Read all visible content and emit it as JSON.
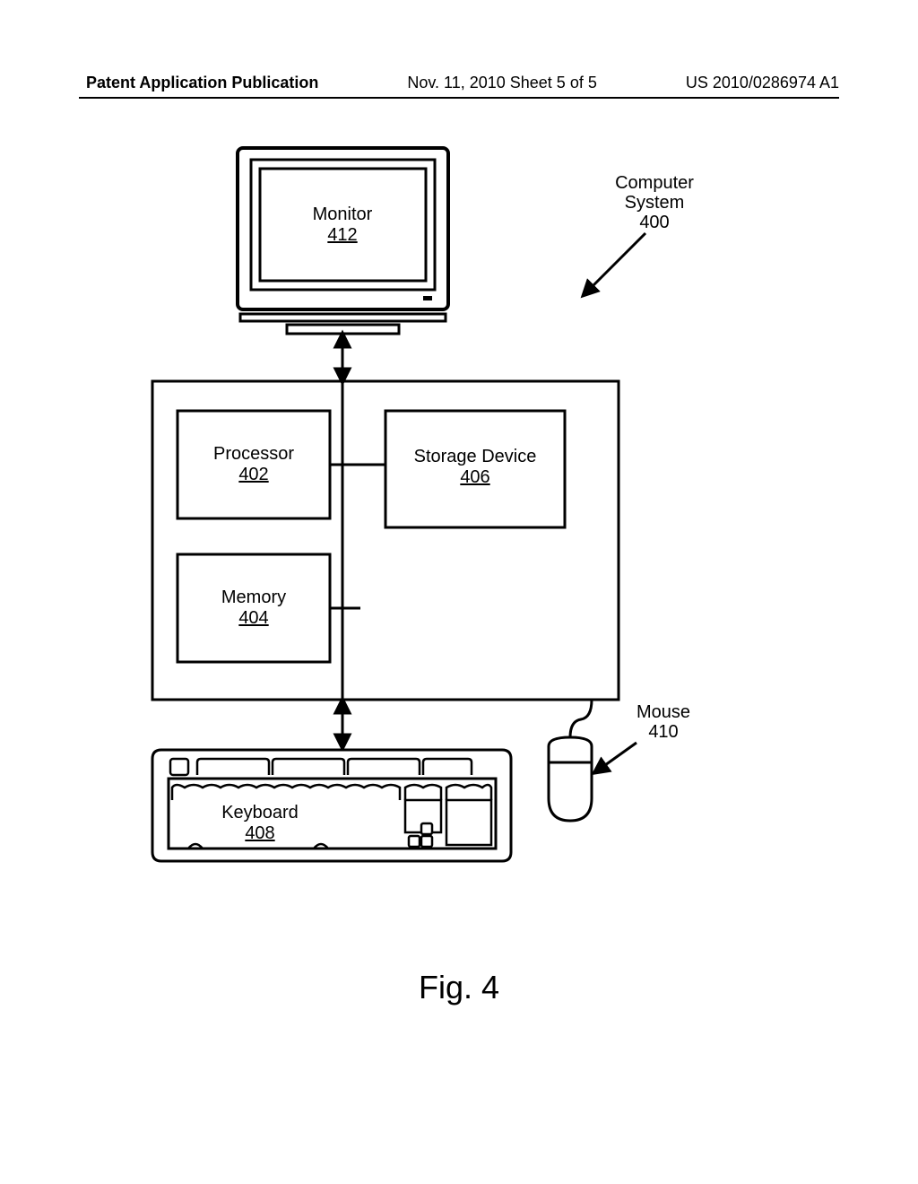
{
  "header": {
    "left": "Patent Application Publication",
    "center": "Nov. 11, 2010  Sheet 5 of 5",
    "right": "US 2010/0286974 A1"
  },
  "figure_caption": "Fig. 4",
  "labels": {
    "system_title_l1": "Computer",
    "system_title_l2": "System",
    "system_ref": "400",
    "monitor_label": "Monitor",
    "monitor_ref": "412",
    "processor_label": "Processor",
    "processor_ref": "402",
    "storage_label": "Storage Device",
    "storage_ref": "406",
    "memory_label": "Memory",
    "memory_ref": "404",
    "keyboard_label": "Keyboard",
    "keyboard_ref": "408",
    "mouse_label": "Mouse",
    "mouse_ref": "410"
  }
}
